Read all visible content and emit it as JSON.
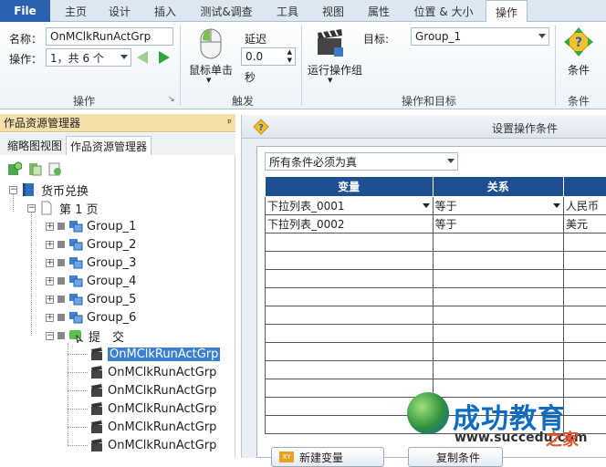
{
  "ribbon_tabs": [
    "File",
    "主页",
    "设计",
    "插入",
    "测试&调查",
    "工具",
    "视图",
    "属性",
    "位置 & 大小",
    "操作"
  ],
  "ribbon": {
    "name_label": "名称：",
    "name_value": "OnMClkRunActGrp",
    "op_label": "操作：",
    "op_value": "1，共 6 个",
    "mouse_click": "鼠标单击",
    "delay_label": "延迟",
    "delay_value": "0.0",
    "sec_label": "秒",
    "run_group": "运行操作组",
    "target_label": "目标:",
    "target_value": "Group_1",
    "condition": "条件",
    "group_labels": [
      "操作",
      "触发",
      "操作和目标",
      "条件"
    ]
  },
  "left_pane": {
    "title": "作品资源管理器",
    "pin": "ᵖ",
    "tabs": [
      "缩略图视图",
      "作品资源管理器"
    ],
    "tree": {
      "root": "货币兑换",
      "page": "第 1 页",
      "groups": [
        "Group_1",
        "Group_2",
        "Group_3",
        "Group_4",
        "Group_5",
        "Group_6"
      ],
      "submit": "提　交",
      "actions": [
        "OnMClkRunActGrp",
        "OnMClkRunActGrp",
        "OnMClkRunActGrp",
        "OnMClkRunActGrp",
        "OnMClkRunActGrp",
        "OnMClkRunActGrp"
      ]
    }
  },
  "dialog": {
    "title": "设置操作条件",
    "mode": "所有条件必须为真",
    "columns": [
      "变量",
      "关系",
      ""
    ],
    "rows": [
      [
        "下拉列表_0001",
        "等于",
        "人民币"
      ],
      [
        "下拉列表_0002",
        "等于",
        "美元"
      ]
    ],
    "buttons": [
      "新建变量",
      "复制条件"
    ]
  },
  "watermark": {
    "brand": "成功教育",
    "url": "www.succedu.com",
    "home": "之家"
  }
}
